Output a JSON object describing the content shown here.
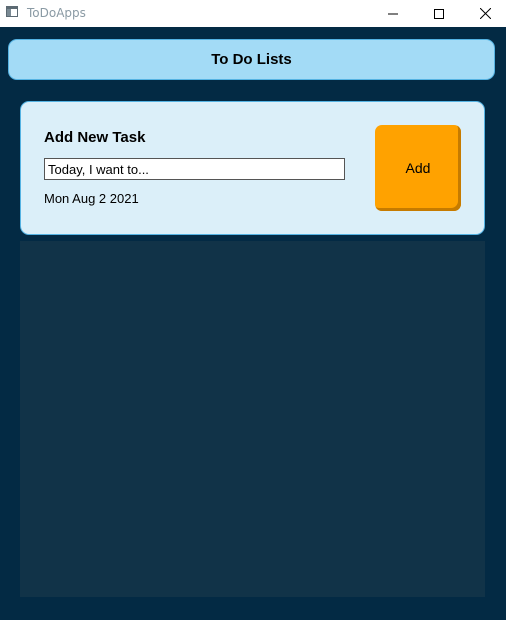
{
  "window": {
    "title": "ToDoApps",
    "icon": "app-window-icon",
    "controls": [
      "minimize-icon",
      "maximize-icon",
      "close-icon"
    ]
  },
  "header": {
    "title": "To Do Lists"
  },
  "new_task": {
    "heading": "Add New Task",
    "input_value": "Today, I want to...",
    "date": "Mon Aug 2 2021",
    "add_label": "Add"
  },
  "task_list": {
    "items": []
  },
  "colors": {
    "background": "#032a44",
    "header_bg": "#a3dbf6",
    "card_bg": "#dbeff9",
    "border_accent": "#55b3e3",
    "add_button": "#ffa200",
    "list_bg": "#113348"
  }
}
